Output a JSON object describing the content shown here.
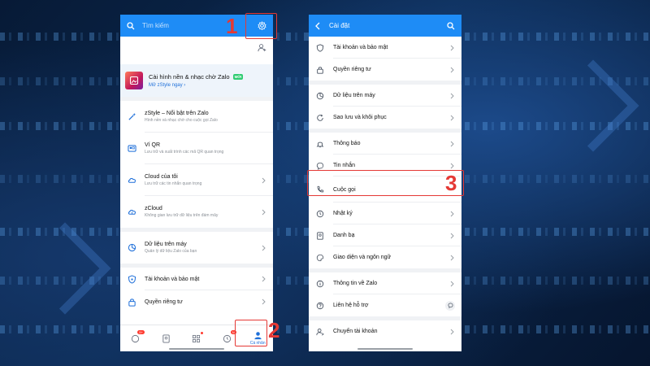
{
  "left_screen": {
    "search_placeholder": "Tìm kiếm",
    "banner": {
      "title": "Cài hình nền & nhạc chờ Zalo",
      "badge": "MỚI",
      "link": "Mở zStyle ngay"
    },
    "items": [
      {
        "label": "zStyle – Nổi bật trên Zalo",
        "sub": "Hình nền và nhạc chờ cho cuộc gọi Zalo"
      },
      {
        "label": "Ví QR",
        "sub": "Lưu trữ và xuất trình các mã QR quan trọng"
      },
      {
        "label": "Cloud của tôi",
        "sub": "Lưu trữ các tin nhắn quan trọng"
      },
      {
        "label": "zCloud",
        "sub": "Không gian lưu trữ dữ liệu trên đám mây"
      },
      {
        "label": "Dữ liệu trên máy",
        "sub": "Quản lý dữ liệu Zalo của bạn"
      },
      {
        "label": "Tài khoản và bảo mật"
      },
      {
        "label": "Quyền riêng tư"
      }
    ],
    "nav": {
      "badge_messages": "5+",
      "badge_timeline": "N",
      "active_label": "Cá nhân"
    }
  },
  "right_screen": {
    "title": "Cài đặt",
    "items": [
      {
        "label": "Tài khoản và bảo mật"
      },
      {
        "label": "Quyền riêng tư"
      },
      {
        "label": "Dữ liệu trên máy"
      },
      {
        "label": "Sao lưu và khôi phục"
      },
      {
        "label": "Thông báo"
      },
      {
        "label": "Tin nhắn"
      },
      {
        "label": "Cuộc gọi"
      },
      {
        "label": "Nhật ký"
      },
      {
        "label": "Danh bạ"
      },
      {
        "label": "Giao diện và ngôn ngữ"
      },
      {
        "label": "Thông tin về Zalo"
      },
      {
        "label": "Liên hệ hỗ trợ"
      },
      {
        "label": "Chuyển tài khoản"
      }
    ]
  },
  "callouts": {
    "step1": "1",
    "step2": "2",
    "step3": "3"
  },
  "colors": {
    "zalo_blue": "#1e8cf6",
    "highlight_red": "#e53935"
  }
}
